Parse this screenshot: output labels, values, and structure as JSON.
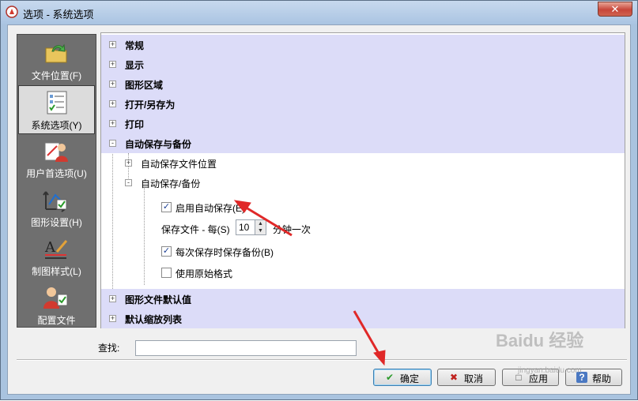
{
  "window": {
    "title": "选项 - 系统选项",
    "close_glyph": "✕"
  },
  "sidebar": {
    "items": [
      {
        "label": "文件位置(F)",
        "icon": "folder-arrow-icon"
      },
      {
        "label": "系统选项(Y)",
        "icon": "checklist-icon",
        "active": true
      },
      {
        "label": "用户首选项(U)",
        "icon": "user-preferences-icon"
      },
      {
        "label": "图形设置(H)",
        "icon": "drawing-settings-icon"
      },
      {
        "label": "制图样式(L)",
        "icon": "drafting-style-icon"
      },
      {
        "label": "配置文件",
        "icon": "profile-icon"
      }
    ]
  },
  "tree": {
    "categories": [
      {
        "label": "常规",
        "expander": "+"
      },
      {
        "label": "显示",
        "expander": "+"
      },
      {
        "label": "图形区域",
        "expander": "+"
      },
      {
        "label": "打开/另存为",
        "expander": "+"
      },
      {
        "label": "打印",
        "expander": "+"
      },
      {
        "label": "自动保存与备份",
        "expander": "-"
      }
    ],
    "sub_items": [
      {
        "label": "自动保存文件位置",
        "expander": "+"
      },
      {
        "label": "自动保存/备份",
        "expander": "-"
      }
    ],
    "options": {
      "enable_autosave": {
        "label": "启用自动保存(E)",
        "checked": true,
        "check_glyph": "✓"
      },
      "save_every": {
        "label": "保存文件 - 每(S)",
        "value": "10",
        "suffix": "分钟一次"
      },
      "backup_each_save": {
        "label": "每次保存时保存备份(B)",
        "checked": true,
        "check_glyph": "✓"
      },
      "use_original_format": {
        "label": "使用原始格式",
        "checked": false
      }
    },
    "bottom_categories": [
      {
        "label": "图形文件默认值",
        "expander": "+"
      },
      {
        "label": "默认缩放列表",
        "expander": "+"
      }
    ]
  },
  "find": {
    "label": "查找:",
    "value": ""
  },
  "buttons": {
    "ok": {
      "label": "确定",
      "icon_glyph": "✔"
    },
    "cancel": {
      "label": "取消",
      "icon_glyph": "✖"
    },
    "apply": {
      "label": "应用",
      "icon_glyph": "□"
    },
    "help": {
      "label": "帮助",
      "icon_glyph": "?"
    }
  },
  "watermark": {
    "text": "Baidu 经验",
    "sub": "jingyan.baidu.com"
  },
  "colors": {
    "category_row": "#dcdcf8",
    "sidebar_bg": "#6f6f6f",
    "annotation_arrow": "#e02828"
  }
}
